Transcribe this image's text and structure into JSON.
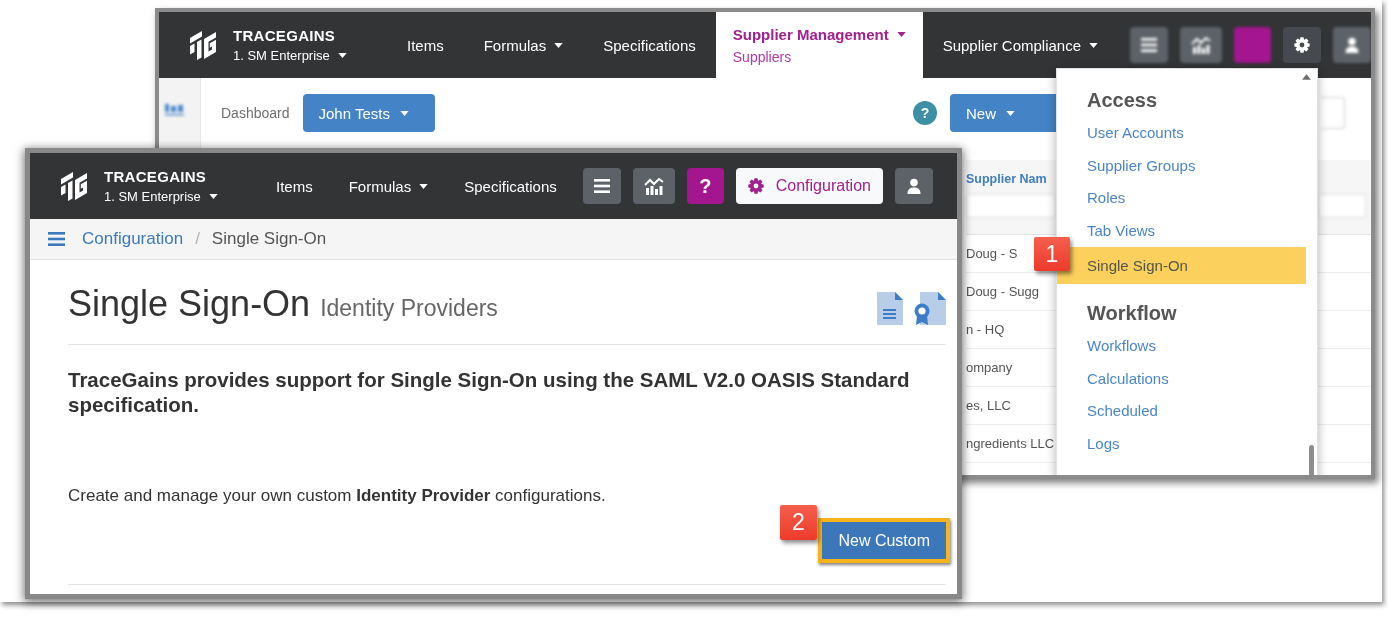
{
  "back_window": {
    "brand": {
      "name": "TRACEGAINS",
      "account": "1. SM Enterprise"
    },
    "nav": [
      {
        "label": "Items",
        "dropdown": false,
        "selected": false
      },
      {
        "label": "Formulas",
        "dropdown": true,
        "selected": false
      },
      {
        "label": "Specifications",
        "dropdown": false,
        "selected": false
      },
      {
        "label": "Supplier Management",
        "dropdown": true,
        "selected": true,
        "sublabel": "Suppliers"
      },
      {
        "label": "Supplier Compliance",
        "dropdown": true,
        "selected": false
      }
    ],
    "toolbar": [
      {
        "kind": "list",
        "blurred": true
      },
      {
        "kind": "chart",
        "blurred": true
      },
      {
        "kind": "help",
        "blurred": true
      },
      {
        "kind": "settings",
        "blurred": false
      },
      {
        "kind": "user",
        "blurred": true
      }
    ],
    "page": {
      "blurred": true,
      "breadcrumb": "Dashboard",
      "view_button": "John Tests",
      "help_button": "?",
      "new_button": "New",
      "table": {
        "column_1": "Supplier Nam",
        "rows": [
          "Doug - S",
          "Doug - Sugg",
          "n - HQ",
          "ompany",
          "es, LLC",
          "ngredients LLC"
        ]
      }
    },
    "dropdown": {
      "sections": [
        {
          "title": "Access",
          "items": [
            {
              "label": "User Accounts",
              "selected": false
            },
            {
              "label": "Supplier Groups",
              "selected": false
            },
            {
              "label": "Roles",
              "selected": false
            },
            {
              "label": "Tab Views",
              "selected": false
            },
            {
              "label": "Single Sign-On",
              "selected": true
            }
          ]
        },
        {
          "title": "Workflow",
          "items": [
            {
              "label": "Workflows",
              "selected": false
            },
            {
              "label": "Calculations",
              "selected": false
            },
            {
              "label": "Scheduled",
              "selected": false
            },
            {
              "label": "Logs",
              "selected": false
            }
          ]
        }
      ]
    }
  },
  "front_window": {
    "brand": {
      "name": "TRACEGAINS",
      "account": "1. SM Enterprise"
    },
    "nav": [
      {
        "label": "Items",
        "dropdown": false
      },
      {
        "label": "Formulas",
        "dropdown": true
      },
      {
        "label": "Specifications",
        "dropdown": false
      }
    ],
    "toolbar": [
      {
        "kind": "list",
        "selected": false
      },
      {
        "kind": "chart",
        "selected": false
      },
      {
        "kind": "help",
        "label": "?",
        "selected": false
      },
      {
        "kind": "settings",
        "label": "Configuration",
        "selected": true
      },
      {
        "kind": "user",
        "selected": false
      }
    ],
    "breadcrumb": [
      {
        "label": "Configuration",
        "link": true
      },
      {
        "label": "Single Sign-On",
        "link": false
      }
    ],
    "breadcrumb_separator": "/",
    "title": "Single Sign-On",
    "subtitle": "Identity Providers",
    "intro": "TraceGains provides support for Single Sign-On using the SAML V2.0 OASIS Standard specification.",
    "description": "Create and manage your own custom **Identity Provider** configurations.",
    "action_button": {
      "label": "New Custom",
      "highlighted": true
    }
  },
  "callouts": [
    {
      "label": "1"
    },
    {
      "label": "2"
    }
  ]
}
